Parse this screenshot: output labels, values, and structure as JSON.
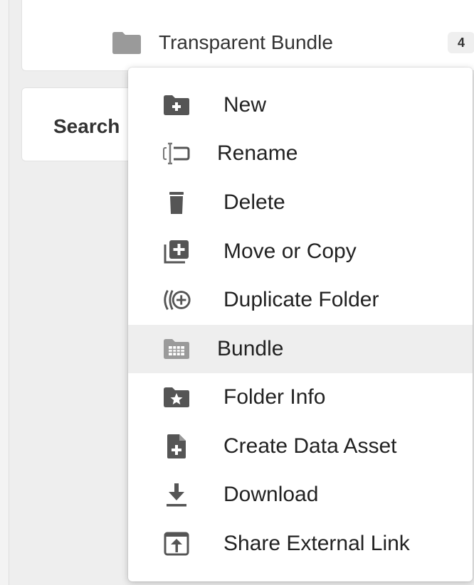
{
  "folder": {
    "name": "Transparent Bundle",
    "count": "4",
    "icon": "folder-icon"
  },
  "search": {
    "label": "Search"
  },
  "menu": {
    "items": [
      {
        "label": "New",
        "icon": "new-folder-icon",
        "highlighted": false
      },
      {
        "label": "Rename",
        "icon": "rename-icon",
        "highlighted": false
      },
      {
        "label": "Delete",
        "icon": "trash-icon",
        "highlighted": false
      },
      {
        "label": "Move or Copy",
        "icon": "move-copy-icon",
        "highlighted": false
      },
      {
        "label": "Duplicate Folder",
        "icon": "duplicate-icon",
        "highlighted": false
      },
      {
        "label": "Bundle",
        "icon": "bundle-icon",
        "highlighted": true
      },
      {
        "label": "Folder Info",
        "icon": "folder-info-icon",
        "highlighted": false
      },
      {
        "label": "Create Data Asset",
        "icon": "create-asset-icon",
        "highlighted": false
      },
      {
        "label": "Download",
        "icon": "download-icon",
        "highlighted": false
      },
      {
        "label": "Share External Link",
        "icon": "share-link-icon",
        "highlighted": false
      }
    ]
  },
  "colors": {
    "icon_gray": "#555555",
    "folder_gray": "#9a9a9a",
    "highlight": "#eeeeee"
  }
}
